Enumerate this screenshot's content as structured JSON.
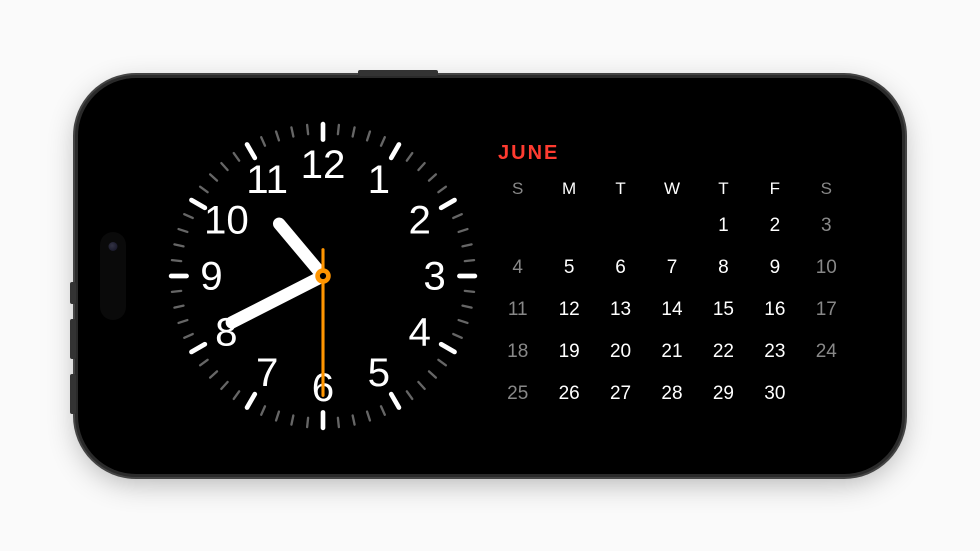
{
  "clock": {
    "hours_labels": [
      "12",
      "1",
      "2",
      "3",
      "4",
      "5",
      "6",
      "7",
      "8",
      "9",
      "10",
      "11"
    ],
    "time": {
      "hour": 10,
      "minute": 40,
      "second": 30
    },
    "accent_color": "#ff9500",
    "hand_color": "#ffffff",
    "tick_major_color": "#ffffff",
    "tick_minor_color": "#666666"
  },
  "calendar": {
    "month_label": "JUNE",
    "accent_color": "#ff3b30",
    "day_headers": [
      "S",
      "M",
      "T",
      "W",
      "T",
      "F",
      "S"
    ],
    "today": 5,
    "weeks": [
      [
        {
          "n": "",
          "outside": true
        },
        {
          "n": "",
          "outside": true
        },
        {
          "n": "",
          "outside": true
        },
        {
          "n": "",
          "outside": true
        },
        {
          "n": "1"
        },
        {
          "n": "2"
        },
        {
          "n": "3",
          "weekend": true
        }
      ],
      [
        {
          "n": "4",
          "weekend": true
        },
        {
          "n": "5",
          "today": true
        },
        {
          "n": "6"
        },
        {
          "n": "7"
        },
        {
          "n": "8"
        },
        {
          "n": "9"
        },
        {
          "n": "10",
          "weekend": true
        }
      ],
      [
        {
          "n": "11",
          "weekend": true
        },
        {
          "n": "12"
        },
        {
          "n": "13"
        },
        {
          "n": "14"
        },
        {
          "n": "15"
        },
        {
          "n": "16"
        },
        {
          "n": "17",
          "weekend": true
        }
      ],
      [
        {
          "n": "18",
          "weekend": true
        },
        {
          "n": "19"
        },
        {
          "n": "20"
        },
        {
          "n": "21"
        },
        {
          "n": "22"
        },
        {
          "n": "23"
        },
        {
          "n": "24",
          "weekend": true
        }
      ],
      [
        {
          "n": "25",
          "weekend": true
        },
        {
          "n": "26"
        },
        {
          "n": "27"
        },
        {
          "n": "28"
        },
        {
          "n": "29"
        },
        {
          "n": "30"
        },
        {
          "n": "",
          "outside": true
        }
      ]
    ]
  }
}
